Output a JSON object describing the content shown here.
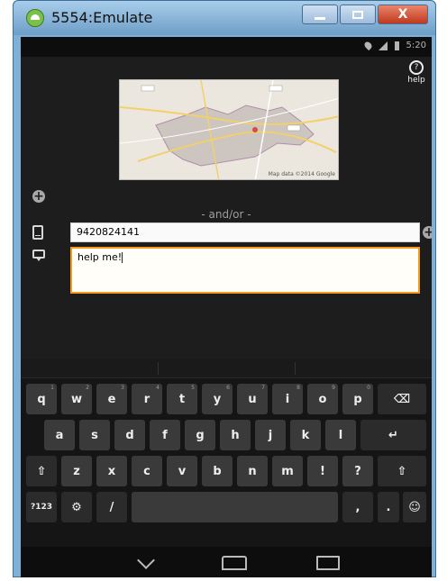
{
  "window": {
    "title": "5554:Emulate",
    "minimize_label": "",
    "maximize_label": "",
    "close_label": "X"
  },
  "statusbar": {
    "time": "5:20"
  },
  "help": {
    "label": "help"
  },
  "map": {
    "attribution": "Map data ©2014 Google"
  },
  "form": {
    "separator": "- and/or -",
    "phone_value": "9420824141",
    "message_value": "help me!"
  },
  "keyboard": {
    "row1": [
      {
        "label": "q",
        "hint": "1"
      },
      {
        "label": "w",
        "hint": "2"
      },
      {
        "label": "e",
        "hint": "3"
      },
      {
        "label": "r",
        "hint": "4"
      },
      {
        "label": "t",
        "hint": "5"
      },
      {
        "label": "y",
        "hint": "6"
      },
      {
        "label": "u",
        "hint": "7"
      },
      {
        "label": "i",
        "hint": "8"
      },
      {
        "label": "o",
        "hint": "9"
      },
      {
        "label": "p",
        "hint": "0"
      }
    ],
    "row2": [
      "a",
      "s",
      "d",
      "f",
      "g",
      "h",
      "j",
      "k",
      "l"
    ],
    "row3": [
      "z",
      "x",
      "c",
      "v",
      "b",
      "n",
      "m",
      "!",
      "?"
    ],
    "symbols_label": "?123",
    "settings_glyph": "⚙",
    "slash_label": "/",
    "comma_label": ",",
    "period_label": ".",
    "emoji_glyph": "☺",
    "backspace_glyph": "⌫",
    "enter_glyph": "↵",
    "shift_glyph": "⇧"
  },
  "icons": {
    "app": "android-icon",
    "add": "plus-icon",
    "phone": "phone-icon",
    "message": "message-icon",
    "help": "help-icon"
  }
}
